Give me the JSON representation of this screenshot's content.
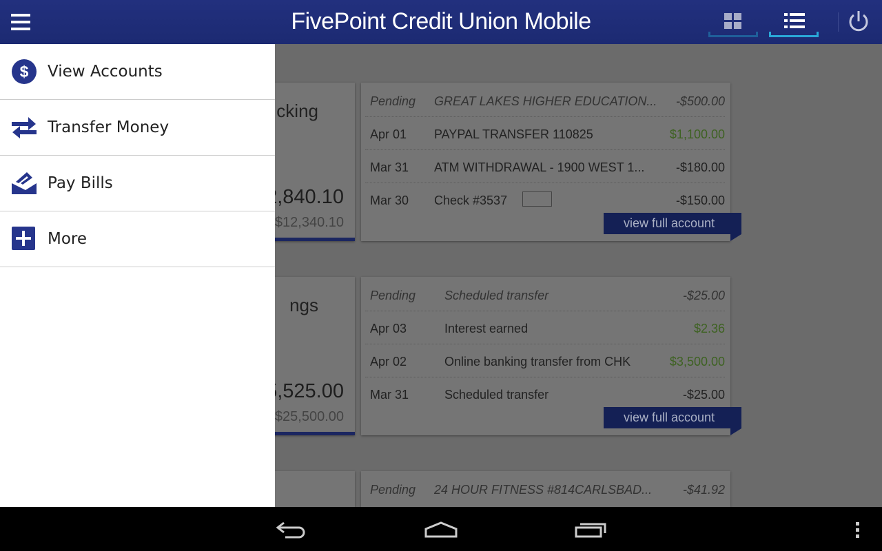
{
  "header": {
    "title": "FivePoint Credit Union Mobile",
    "icons": [
      "menu-icon",
      "grid-view-icon",
      "list-view-icon",
      "power-icon"
    ],
    "active_view": "list"
  },
  "sidebar": {
    "items": [
      {
        "label": "View Accounts",
        "icon": "dollar-circle-icon"
      },
      {
        "label": "Transfer Money",
        "icon": "transfer-arrows-icon"
      },
      {
        "label": "Pay Bills",
        "icon": "pay-bills-icon"
      },
      {
        "label": "More",
        "icon": "plus-square-icon"
      }
    ]
  },
  "accounts": [
    {
      "name": "cking",
      "balance": "2,840.10",
      "available": "$12,340.10",
      "view_label": "view full account",
      "transactions": [
        {
          "date": "Pending",
          "desc": "GREAT LAKES HIGHER EDUCATION...",
          "amount": "-$500.00",
          "pending": true
        },
        {
          "date": "Apr 01",
          "desc": "PAYPAL TRANSFER 110825",
          "amount": "$1,100.00",
          "credit": true
        },
        {
          "date": "Mar 31",
          "desc": "ATM WITHDRAWAL - 1900 WEST 1...",
          "amount": "-$180.00"
        },
        {
          "date": "Mar 30",
          "desc": "Check #3537",
          "amount": "-$150.00",
          "check_image": true
        }
      ]
    },
    {
      "name": "ngs",
      "balance": "5,525.00",
      "available": "$25,500.00",
      "view_label": "view full account",
      "transactions": [
        {
          "date": "Pending",
          "desc": "Scheduled transfer",
          "amount": "-$25.00",
          "pending": true
        },
        {
          "date": "Apr 03",
          "desc": "Interest earned",
          "amount": "$2.36",
          "credit": true
        },
        {
          "date": "Apr 02",
          "desc": "Online banking transfer from CHK",
          "amount": "$3,500.00",
          "credit": true
        },
        {
          "date": "Mar 31",
          "desc": "Scheduled transfer",
          "amount": "-$25.00"
        }
      ]
    },
    {
      "transactions": [
        {
          "date": "Pending",
          "desc": "24 HOUR FITNESS #814CARLSBAD...",
          "amount": "-$41.92",
          "pending": true
        }
      ]
    }
  ],
  "colors": {
    "brand": "#22307e",
    "accent": "#2aa8d8",
    "credit": "#3e6222",
    "icon": "#26358c"
  },
  "navbar": {
    "icons": [
      "back-icon",
      "home-icon",
      "recent-apps-icon",
      "overflow-menu-icon"
    ]
  }
}
